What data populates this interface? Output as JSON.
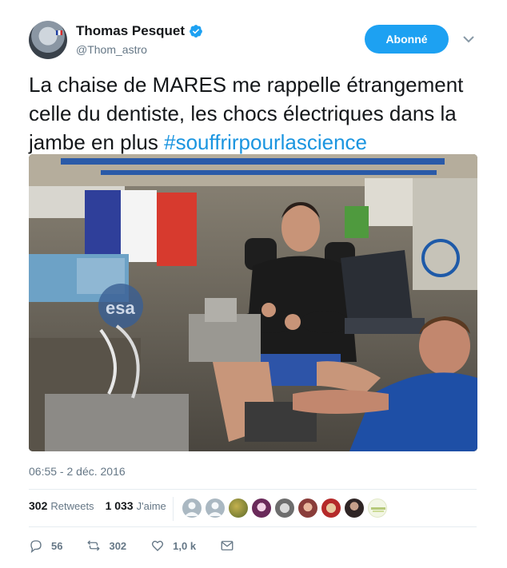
{
  "author": {
    "name": "Thomas Pesquet",
    "handle": "@Thom_astro",
    "verified": true
  },
  "follow_button": {
    "label": "Abonné"
  },
  "tweet": {
    "text_plain": "La chaise de MARES me rappelle étrangement celle du dentiste, les chocs électriques dans la jambe en plus ",
    "hashtag": "#souffrirpourlascience",
    "timestamp": "06:55 - 2 déc. 2016"
  },
  "stats": {
    "retweets_count": "302",
    "retweets_label": "Retweets",
    "likes_count": "1 033",
    "likes_label": "J'aime"
  },
  "likers": [
    {
      "icon": "default-avatar-icon",
      "color": "#aab8c2"
    },
    {
      "icon": "default-avatar-icon",
      "color": "#aab8c2"
    },
    {
      "icon": "landscape-avatar",
      "color": "#8a7a3a"
    },
    {
      "icon": "anime-avatar",
      "color": "#6a2a5a"
    },
    {
      "icon": "animal-avatar",
      "color": "#7d7d7d"
    },
    {
      "icon": "person-avatar",
      "color": "#a0504a"
    },
    {
      "icon": "dog-avatar",
      "color": "#b03030"
    },
    {
      "icon": "person-avatar",
      "color": "#4a3a3a"
    },
    {
      "icon": "logo-avatar",
      "color": "#c9d98a"
    }
  ],
  "actions": {
    "reply_count": "56",
    "retweet_count": "302",
    "like_count": "1,0 k"
  },
  "colors": {
    "accent": "#1da1f2",
    "hashtag": "#1b95e0",
    "muted": "#657786",
    "text": "#14171a"
  }
}
